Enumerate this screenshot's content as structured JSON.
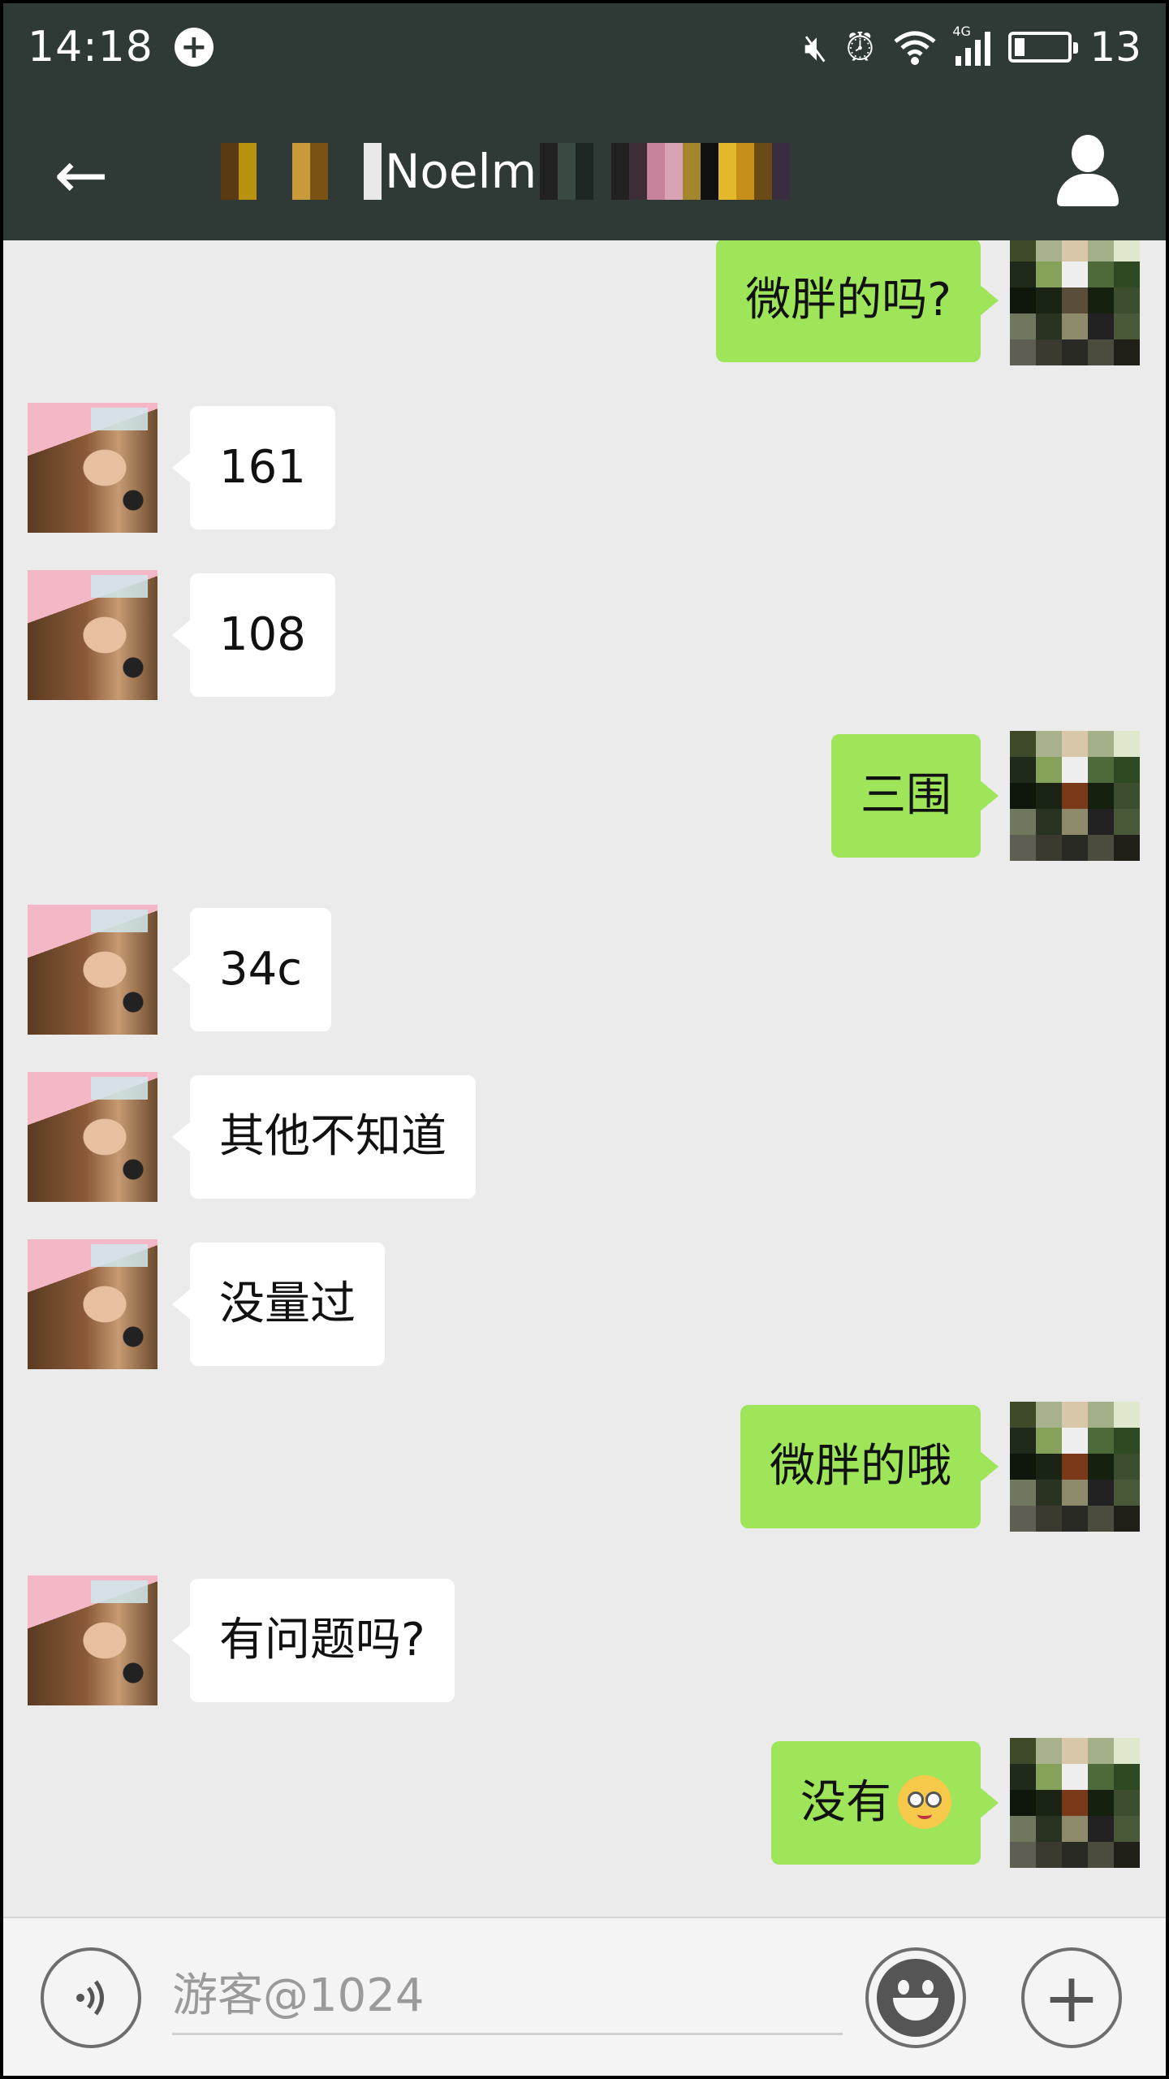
{
  "status_bar": {
    "time": "14:18",
    "network_label": "4G",
    "battery": "13",
    "icons": [
      "notification-icon",
      "mute-icon",
      "alarm-icon",
      "wifi-icon",
      "signal-icon",
      "battery-icon"
    ]
  },
  "header": {
    "title": "Noelm",
    "back_icon": "back-arrow-icon",
    "profile_icon": "profile-icon"
  },
  "messages": [
    {
      "side": "right",
      "text": "微胖的吗?"
    },
    {
      "side": "left",
      "text": "161"
    },
    {
      "side": "left",
      "text": "108"
    },
    {
      "side": "right",
      "text": "三围"
    },
    {
      "side": "left",
      "text": "34c"
    },
    {
      "side": "left",
      "text": "其他不知道"
    },
    {
      "side": "left",
      "text": "没量过"
    },
    {
      "side": "right",
      "text": "微胖的哦"
    },
    {
      "side": "left",
      "text": "有问题吗?"
    },
    {
      "side": "right",
      "text": "没有",
      "emoji": "embarrassed-emoji"
    }
  ],
  "input_bar": {
    "placeholder": "游客@1024",
    "voice_icon": "voice-icon",
    "emoji_icon": "emoji-icon",
    "plus_icon": "plus-icon"
  },
  "colors": {
    "header_bg": "#2f3a37",
    "chat_bg": "#ebebeb",
    "sent_bubble": "#9ee55a",
    "received_bubble": "#ffffff"
  }
}
